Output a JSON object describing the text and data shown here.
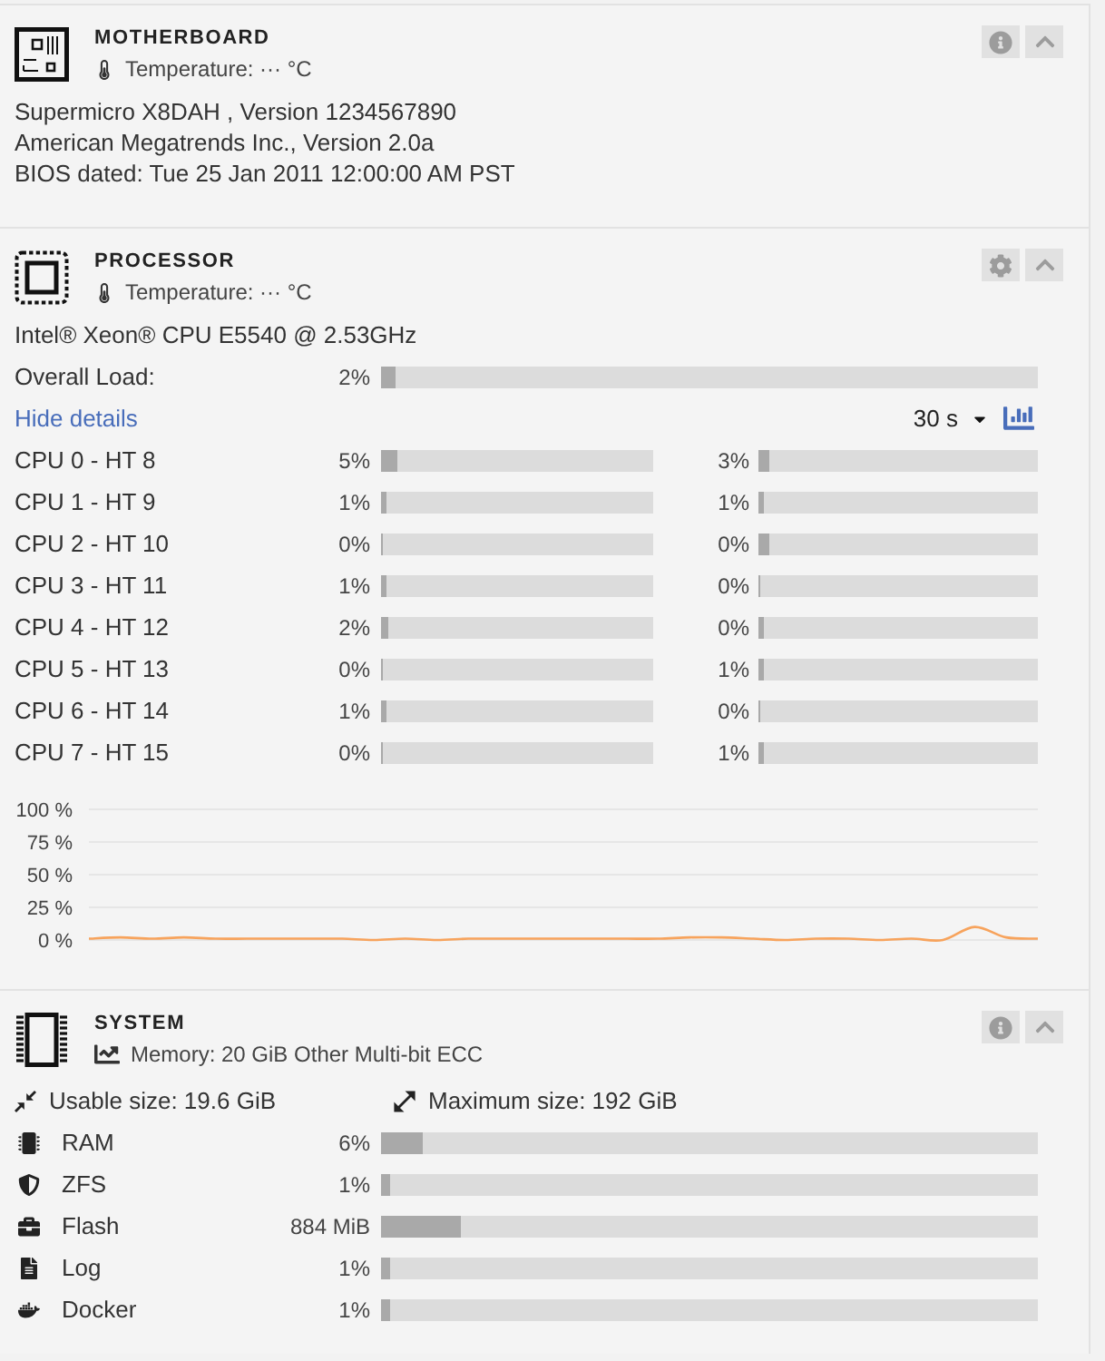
{
  "motherboard": {
    "title": "MOTHERBOARD",
    "temperature": "Temperature: ··· °C",
    "buttons": [
      {
        "kind": "info"
      },
      {
        "kind": "collapse"
      }
    ],
    "lines": [
      "Supermicro X8DAH , Version 1234567890",
      "American Megatrends Inc., Version 2.0a",
      "BIOS dated: Tue 25 Jan 2011 12:00:00 AM PST"
    ]
  },
  "processor": {
    "title": "PROCESSOR",
    "temperature": "Temperature: ··· °C",
    "buttons": [
      {
        "kind": "settings"
      },
      {
        "kind": "collapse"
      }
    ],
    "model": "Intel® Xeon® CPU E5540 @ 2.53GHz",
    "overall_load": {
      "label": "Overall Load:",
      "reading": "2%",
      "level": 0.02
    },
    "details_link": "Hide details",
    "interval": "30 s",
    "cores": [
      {
        "label": "CPU 0 - HT 8",
        "meters": [
          {
            "reading": "5%",
            "level": 0.05
          },
          {
            "reading": "3%",
            "level": 0.03
          }
        ]
      },
      {
        "label": "CPU 1 - HT 9",
        "meters": [
          {
            "reading": "1%",
            "level": 0.01
          },
          {
            "reading": "1%",
            "level": 0.01
          }
        ]
      },
      {
        "label": "CPU 2 - HT 10",
        "meters": [
          {
            "reading": "0%",
            "level": 0
          },
          {
            "reading": "0%",
            "level": 0.03
          }
        ]
      },
      {
        "label": "CPU 3 - HT 11",
        "meters": [
          {
            "reading": "1%",
            "level": 0.01
          },
          {
            "reading": "0%",
            "level": 0
          }
        ]
      },
      {
        "label": "CPU 4 - HT 12",
        "meters": [
          {
            "reading": "2%",
            "level": 0.02
          },
          {
            "reading": "0%",
            "level": 0.01
          }
        ]
      },
      {
        "label": "CPU 5 - HT 13",
        "meters": [
          {
            "reading": "0%",
            "level": 0
          },
          {
            "reading": "1%",
            "level": 0.01
          }
        ]
      },
      {
        "label": "CPU 6 - HT 14",
        "meters": [
          {
            "reading": "1%",
            "level": 0.01
          },
          {
            "reading": "0%",
            "level": 0
          }
        ]
      },
      {
        "label": "CPU 7 - HT 15",
        "meters": [
          {
            "reading": "0%",
            "level": 0
          },
          {
            "reading": "1%",
            "level": 0.01
          }
        ]
      }
    ],
    "chart_data": {
      "type": "line",
      "grid": true,
      "ylim": [
        0,
        100
      ],
      "yticks": [
        {
          "value": 100,
          "label": "100 %"
        },
        {
          "value": 75,
          "label": "75 %"
        },
        {
          "value": 50,
          "label": "50 %"
        },
        {
          "value": 25,
          "label": "25 %"
        },
        {
          "value": 0,
          "label": "0 %"
        }
      ],
      "series": [
        {
          "color": "#f7a35c",
          "values": [
            1,
            2,
            1,
            2,
            1,
            1,
            1,
            1,
            1,
            0,
            1,
            0,
            1,
            1,
            1,
            1,
            1,
            1,
            1,
            2,
            2,
            1,
            0,
            1,
            1,
            0,
            1,
            0,
            10,
            2,
            1
          ]
        }
      ]
    }
  },
  "system": {
    "title": "SYSTEM",
    "memory": "Memory: 20 GiB Other Multi-bit ECC",
    "buttons": [
      {
        "kind": "info"
      },
      {
        "kind": "collapse"
      }
    ],
    "usable_size": "Usable size: 19.6 GiB",
    "maximum_size": "Maximum size: 192 GiB",
    "usage": [
      {
        "kind": "ram",
        "label": "RAM",
        "reading": "6%",
        "level": 0.06
      },
      {
        "kind": "zfs",
        "label": "ZFS",
        "reading": "1%",
        "level": 0.01
      },
      {
        "kind": "flash",
        "label": "Flash",
        "reading": "884 MiB",
        "level": 0.12
      },
      {
        "kind": "log",
        "label": "Log",
        "reading": "1%",
        "level": 0.01
      },
      {
        "kind": "docker",
        "label": "Docker",
        "reading": "1%",
        "level": 0.01
      }
    ]
  }
}
